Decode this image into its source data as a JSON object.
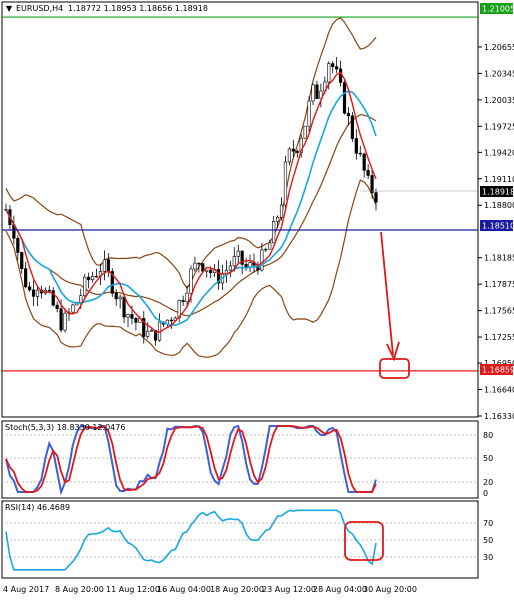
{
  "header": {
    "arrow": "▼",
    "symbol": "EURUSD,H4",
    "quotes": "1.18772 1.18953 1.18656 1.18918"
  },
  "price_axis": {
    "ticks": [
      "1.20655",
      "1.20345",
      "1.20035",
      "1.19725",
      "1.19420",
      "1.19110",
      "1.18800",
      "1.18185",
      "1.17875",
      "1.17565",
      "1.17255",
      "1.16950",
      "1.16640",
      "1.16330"
    ],
    "current": "1.18918",
    "level_top": "1.21005",
    "level_mid": "1.18510",
    "level_low": "1.16859"
  },
  "stoch": {
    "label": "Stoch(5,3,3) 18.8330 12.0476",
    "ticks": [
      "80",
      "50",
      "20",
      "0"
    ]
  },
  "rsi": {
    "label": "RSI(14) 46.4689",
    "ticks": [
      "70",
      "50",
      "30"
    ]
  },
  "time_axis": [
    "4 Aug 2017",
    "8 Aug 20:00",
    "11 Aug 12:00",
    "16 Aug 04:00",
    "18 Aug 20:00",
    "23 Aug 12:00",
    "28 Aug 04:00",
    "30 Aug 20:00"
  ],
  "colors": {
    "level_top": "#16a016",
    "level_mid": "#1a1aa0",
    "level_low": "#e01818",
    "fast_ma": "#e01818",
    "slow_ma": "#18a8e0",
    "bands": "#8b4513",
    "stoch_main": "#4060d8",
    "stoch_signal": "#e01818",
    "rsi": "#18a8e0",
    "annotation": "#e01818"
  },
  "chart_data": {
    "type": "candlestick",
    "symbol": "EURUSD",
    "timeframe": "H4",
    "x": [
      "4 Aug 2017",
      "8 Aug 20:00",
      "11 Aug 12:00",
      "16 Aug 04:00",
      "18 Aug 20:00",
      "23 Aug 12:00",
      "28 Aug 04:00",
      "30 Aug 20:00"
    ],
    "ohlc_last": {
      "open": 1.18772,
      "high": 1.18953,
      "low": 1.18656,
      "close": 1.18918
    },
    "ylim": [
      1.1633,
      1.2117
    ],
    "levels": [
      1.21005,
      1.1851,
      1.16859
    ],
    "price_path": [
      1.1875,
      1.185,
      1.18,
      1.1778,
      1.179,
      1.1775,
      1.176,
      1.174,
      1.1755,
      1.177,
      1.179,
      1.18,
      1.181,
      1.1792,
      1.177,
      1.1755,
      1.1745,
      1.1735,
      1.1725,
      1.1735,
      1.1745,
      1.1755,
      1.1775,
      1.18,
      1.1815,
      1.1808,
      1.1795,
      1.18,
      1.1812,
      1.1816,
      1.1805,
      1.1812,
      1.1818,
      1.184,
      1.188,
      1.1925,
      1.1955,
      1.1975,
      1.2,
      1.2025,
      1.2055,
      1.2035,
      1.2,
      1.1965,
      1.1935,
      1.1905,
      1.1892
    ],
    "stochastic": {
      "k": 18.833,
      "d": 12.0476,
      "levels": [
        80,
        50,
        20
      ]
    },
    "rsi": {
      "value": 46.4689,
      "levels": [
        70,
        50,
        30
      ]
    }
  }
}
